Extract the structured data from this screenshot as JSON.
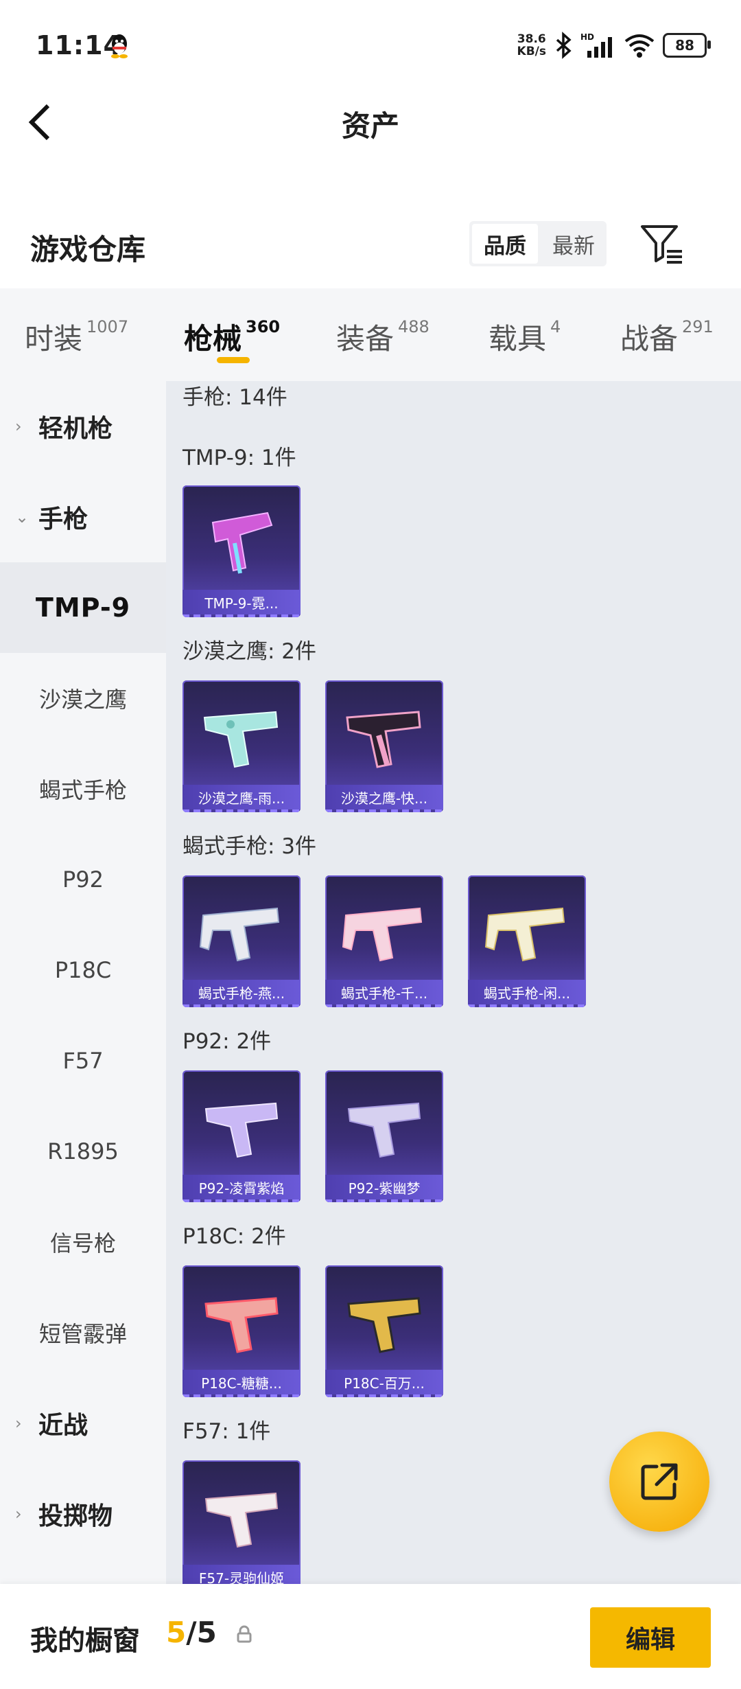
{
  "status_bar": {
    "time": "11:14",
    "net_speed_value": "38.6",
    "net_speed_unit": "KB/s",
    "battery": "88"
  },
  "header": {
    "title": "资产"
  },
  "warehouse": {
    "title": "游戏仓库",
    "sort_quality": "品质",
    "sort_latest": "最新"
  },
  "tabs": [
    {
      "label": "时装",
      "count": "1007"
    },
    {
      "label": "枪械",
      "count": "360"
    },
    {
      "label": "装备",
      "count": "488"
    },
    {
      "label": "载具",
      "count": "4"
    },
    {
      "label": "战备",
      "count": "291"
    }
  ],
  "sidebar": {
    "items": [
      {
        "label": "轻机枪"
      },
      {
        "label": "手枪"
      },
      {
        "label": "TMP-9"
      },
      {
        "label": "沙漠之鹰"
      },
      {
        "label": "蝎式手枪"
      },
      {
        "label": "P92"
      },
      {
        "label": "P18C"
      },
      {
        "label": "F57"
      },
      {
        "label": "R1895"
      },
      {
        "label": "信号枪"
      },
      {
        "label": "短管霰弹"
      },
      {
        "label": "近战"
      },
      {
        "label": "投掷物"
      }
    ]
  },
  "content": {
    "summary": "手枪: 14件",
    "sections": [
      {
        "heading": "TMP-9: 1件",
        "items": [
          {
            "label": "TMP-9-霓..."
          }
        ]
      },
      {
        "heading": "沙漠之鹰: 2件",
        "items": [
          {
            "label": "沙漠之鹰-雨..."
          },
          {
            "label": "沙漠之鹰-快..."
          }
        ]
      },
      {
        "heading": "蝎式手枪: 3件",
        "items": [
          {
            "label": "蝎式手枪-燕..."
          },
          {
            "label": "蝎式手枪-千..."
          },
          {
            "label": "蝎式手枪-闲..."
          }
        ]
      },
      {
        "heading": "P92: 2件",
        "items": [
          {
            "label": "P92-凌霄紫焰"
          },
          {
            "label": "P92-紫幽梦"
          }
        ]
      },
      {
        "heading": "P18C: 2件",
        "items": [
          {
            "label": "P18C-糖糖..."
          },
          {
            "label": "P18C-百万..."
          }
        ]
      },
      {
        "heading": "F57: 1件",
        "items": [
          {
            "label": "F57-灵驹仙姬"
          }
        ]
      }
    ]
  },
  "bottom_bar": {
    "title": "我的橱窗",
    "current": "5",
    "separator": "/",
    "total": "5",
    "edit_label": "编辑"
  },
  "colors": {
    "accent": "#f5b400",
    "card_bg": "#3b2e78"
  }
}
